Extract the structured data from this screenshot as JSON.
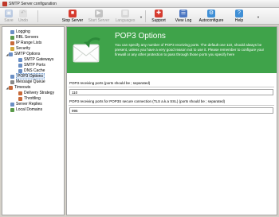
{
  "window": {
    "title": "SMTP Server configuration"
  },
  "toolbar": [
    {
      "label": "Save",
      "enabled": false,
      "icon": "save-icon"
    },
    {
      "label": "Undo",
      "enabled": false,
      "icon": "undo-icon"
    },
    {
      "label": "Stop Server",
      "enabled": true,
      "icon": "stop-server-icon"
    },
    {
      "label": "Start Server",
      "enabled": false,
      "icon": "start-server-icon"
    },
    {
      "label": "Languages",
      "enabled": false,
      "icon": "languages-icon"
    },
    {
      "label": "Support",
      "enabled": true,
      "icon": "support-icon"
    },
    {
      "label": "View Log",
      "enabled": true,
      "icon": "view-log-icon"
    },
    {
      "label": "Autoconfigure",
      "enabled": true,
      "icon": "autoconfigure-icon"
    },
    {
      "label": "Help",
      "enabled": true,
      "icon": "help-icon"
    }
  ],
  "tree": [
    {
      "label": "Logging",
      "level": 1,
      "color": "#6b8fc4"
    },
    {
      "label": "RBL Servers",
      "level": 1,
      "color": "#5a9a4a"
    },
    {
      "label": "IP Range Lists",
      "level": 1,
      "color": "#c86a3a"
    },
    {
      "label": "Security",
      "level": 1,
      "color": "#d2a93a"
    },
    {
      "label": "SMTP Options",
      "level": 1,
      "color": "#6b8fc4",
      "expanded": true
    },
    {
      "label": "SMTP Gateways",
      "level": 2,
      "color": "#6b8fc4"
    },
    {
      "label": "SMTP Ports",
      "level": 2,
      "color": "#6b8fc4"
    },
    {
      "label": "DNS Cache",
      "level": 2,
      "color": "#6b8fc4"
    },
    {
      "label": "POP3 Options",
      "level": 1,
      "color": "#6b8fc4",
      "selected": true
    },
    {
      "label": "Message Queue",
      "level": 1,
      "color": "#8a8a8a"
    },
    {
      "label": "Timeouts",
      "level": 1,
      "color": "#c86a3a",
      "expanded": true
    },
    {
      "label": "Delivery Strategy",
      "level": 2,
      "color": "#c86a3a"
    },
    {
      "label": "Throttling",
      "level": 2,
      "color": "#c86a3a"
    },
    {
      "label": "Server Replies",
      "level": 1,
      "color": "#6b8fc4"
    },
    {
      "label": "Local Domains",
      "level": 1,
      "color": "#5a9a4a"
    }
  ],
  "banner": {
    "title": "POP3 Options",
    "description": "You can specify any number of POP3 receiving ports. The default one 110, should always be present, unless you have a very good reason not to use it. Please remember to configure your firewall or any other protection to pass through those ports you specify here",
    "color": "#3fa34a"
  },
  "fields": [
    {
      "label": "POP3 receiving ports (ports should be ; separated)",
      "value": "110"
    },
    {
      "label": "POP3 receiving ports for POP3S secure connection (TLS a.k.a SSL) (ports should be ; separated)",
      "value": "995"
    }
  ]
}
